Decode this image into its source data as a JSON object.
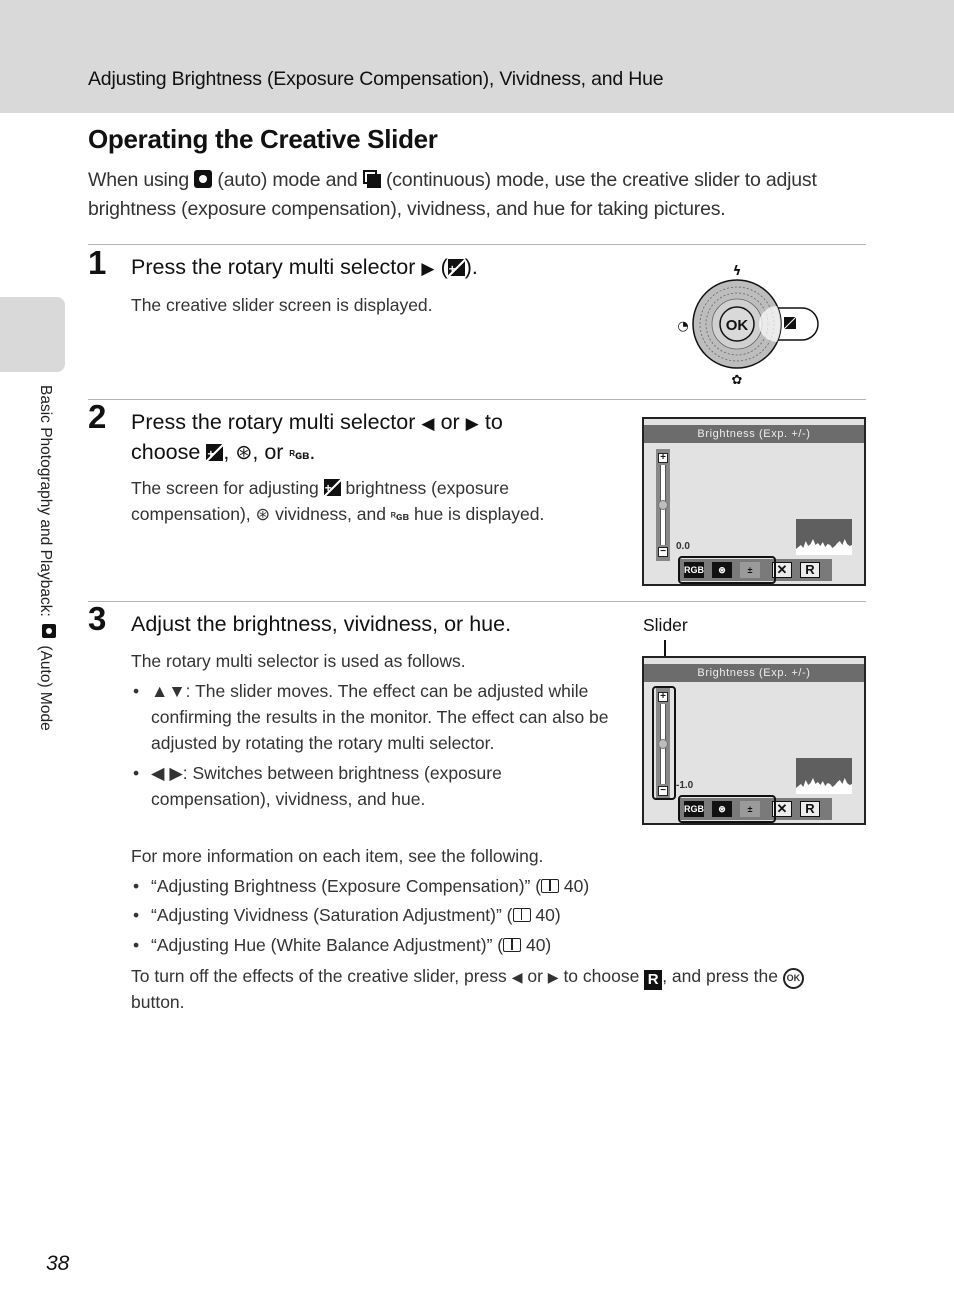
{
  "header": {
    "section_title": "Adjusting Brightness (Exposure Compensation), Vividness, and Hue"
  },
  "side_tab": {
    "text_before": "Basic Photography and Playback:",
    "icon": "camera-auto-icon",
    "text_after": "(Auto) Mode"
  },
  "page_title": "Operating the Creative Slider",
  "intro": {
    "part1": "When using",
    "icon1": "camera-auto-icon",
    "part2": "(auto) mode and",
    "icon2": "continuous-mode-icon",
    "part3": "(continuous) mode, use the creative slider to adjust brightness (exposure compensation), vividness, and hue for taking pictures."
  },
  "steps": [
    {
      "number": "1",
      "heading_part1": "Press the rotary multi selector",
      "heading_arrow": "▶",
      "heading_part2": "(",
      "heading_part3": ").",
      "body": "The creative slider screen is displayed."
    },
    {
      "number": "2",
      "heading_part1": "Press the rotary multi selector",
      "heading_left": "◀",
      "heading_or": "or",
      "heading_right": "▶",
      "heading_part2": "to",
      "heading_line2_a": "choose",
      "heading_line2_b": ",",
      "heading_line2_c": ", or",
      "heading_line2_d": ".",
      "body_a": "The screen for adjusting",
      "body_b": "brightness (exposure",
      "body_c": "compensation),",
      "body_d": "vividness, and",
      "body_e": "hue is displayed."
    },
    {
      "number": "3",
      "heading": "Adjust the brightness, vividness, or hue.",
      "body_intro": "The rotary multi selector is used as follows.",
      "bullets": [
        {
          "keys": "▲▼",
          "text": ": The slider moves. The effect can be adjusted while confirming the results in the monitor. The effect can also be adjusted by rotating the rotary multi selector."
        },
        {
          "keys": "◀ ▶",
          "text": ": Switches between brightness (exposure compensation), vividness, and hue."
        }
      ],
      "more_info": "For more information on each item, see the following.",
      "references": [
        {
          "title": "“Adjusting Brightness (Exposure Compensation)” (",
          "page": "40)"
        },
        {
          "title": "“Adjusting Vividness (Saturation Adjustment)” (",
          "page": "40)"
        },
        {
          "title": "“Adjusting Hue (White Balance Adjustment)” (",
          "page": "40)"
        }
      ],
      "turn_off_a": "To turn off the effects of the creative slider, press",
      "turn_off_left": "◀",
      "turn_off_or": "or",
      "turn_off_right": "▶",
      "turn_off_b": "to choose",
      "turn_off_r": "R",
      "turn_off_c": ", and press the",
      "turn_off_ok": "OK",
      "turn_off_d": "button."
    }
  ],
  "rotary_selector": {
    "center_label": "OK",
    "top_icon": "flash-icon",
    "left_icon": "self-timer-icon",
    "bottom_icon": "macro-icon",
    "right_icon": "exposure-compensation-icon"
  },
  "screens": [
    {
      "title": "Brightness (Exp. +/-)",
      "value": "0.0",
      "slider_fraction": 0.5,
      "menu": [
        "hue",
        "vividness",
        "brightness",
        "cancel",
        "reset"
      ],
      "active": "brightness"
    },
    {
      "title": "Brightness (Exp. +/-)",
      "value": "-1.0",
      "slider_fraction": 0.5,
      "menu": [
        "hue",
        "vividness",
        "brightness",
        "cancel",
        "reset"
      ],
      "active": "brightness"
    }
  ],
  "callout": {
    "slider_label": "Slider"
  },
  "menu_glyphs": {
    "hue": "RGB",
    "vividness": "⊛",
    "brightness": "±",
    "cancel": "✕",
    "reset": "R"
  },
  "page_number": "38"
}
